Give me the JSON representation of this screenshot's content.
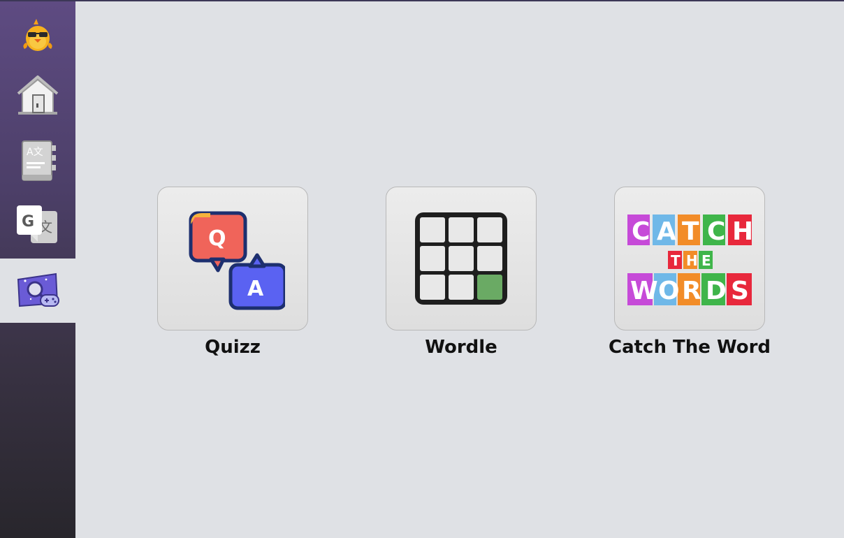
{
  "sidebar": {
    "items": [
      {
        "name": "app-logo",
        "icon": "chick-mascot-icon",
        "active": false
      },
      {
        "name": "home",
        "icon": "home-icon",
        "active": false
      },
      {
        "name": "dictionary",
        "icon": "dictionary-book-icon",
        "active": false
      },
      {
        "name": "translate",
        "icon": "google-translate-icon",
        "active": true
      },
      {
        "name": "games",
        "icon": "game-controller-icon",
        "active": true
      }
    ],
    "accent": "#5e4b82"
  },
  "games": [
    {
      "label": "Quizz",
      "icon": "quiz-qa-icon",
      "q": "Q",
      "a": "A"
    },
    {
      "label": "Wordle",
      "icon": "wordle-grid-icon"
    },
    {
      "label": "Catch The Word",
      "icon": "catch-the-words-logo",
      "logo_lines": [
        "CATCH",
        "THE",
        "WORDS"
      ]
    }
  ],
  "translate_icon": {
    "g": "G",
    "wen": "文"
  },
  "dictionary_icon": {
    "text": "A文"
  }
}
